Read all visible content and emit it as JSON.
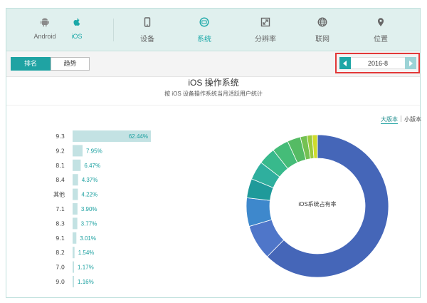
{
  "nav": {
    "platforms": [
      {
        "key": "android",
        "label": "Android",
        "icon": "android-icon",
        "active": false
      },
      {
        "key": "ios",
        "label": "iOS",
        "icon": "apple-icon",
        "active": true
      }
    ],
    "categories": [
      {
        "key": "device",
        "label": "设备",
        "icon": "phone-icon",
        "active": false
      },
      {
        "key": "system",
        "label": "系统",
        "icon": "system-icon",
        "active": true
      },
      {
        "key": "resolution",
        "label": "分辨率",
        "icon": "resize-icon",
        "active": false
      },
      {
        "key": "network",
        "label": "联网",
        "icon": "globe-icon",
        "active": false
      },
      {
        "key": "location",
        "label": "位置",
        "icon": "map-pin-icon",
        "active": false
      }
    ]
  },
  "toolbar": {
    "tabs": {
      "rank": "排名",
      "trend": "趋势"
    },
    "date": "2016-8"
  },
  "version_toggle": {
    "major": "大版本",
    "minor": "小版本"
  },
  "colors": {
    "accent": "#1fa3a3",
    "bar": "#c3e2e3",
    "bar_label": "#1aa0a0",
    "highlight": "#e23838"
  },
  "chart_data": {
    "type": "bar",
    "title": "iOS 操作系统",
    "subtitle": "按 iOS 设备操作系统当月活跃用户统计",
    "categories": [
      "9.3",
      "9.2",
      "8.1",
      "8.4",
      "其他",
      "7.1",
      "8.3",
      "9.1",
      "8.2",
      "7.0",
      "9.0"
    ],
    "values": [
      62.44,
      7.95,
      6.47,
      4.37,
      4.22,
      3.9,
      3.77,
      3.01,
      1.54,
      1.17,
      1.16
    ],
    "value_labels": [
      "62.44%",
      "7.95%",
      "6.47%",
      "4.37%",
      "4.22%",
      "3.90%",
      "3.77%",
      "3.01%",
      "1.54%",
      "1.17%",
      "1.16%"
    ],
    "donut": {
      "center_label": "iOS系统占有率",
      "colors": [
        "#4566b8",
        "#4f76c9",
        "#3e88cc",
        "#1f9a9a",
        "#2faf9e",
        "#38b98c",
        "#45bc78",
        "#55bb64",
        "#74c152",
        "#9ccb3d",
        "#cfdb2c"
      ]
    }
  }
}
